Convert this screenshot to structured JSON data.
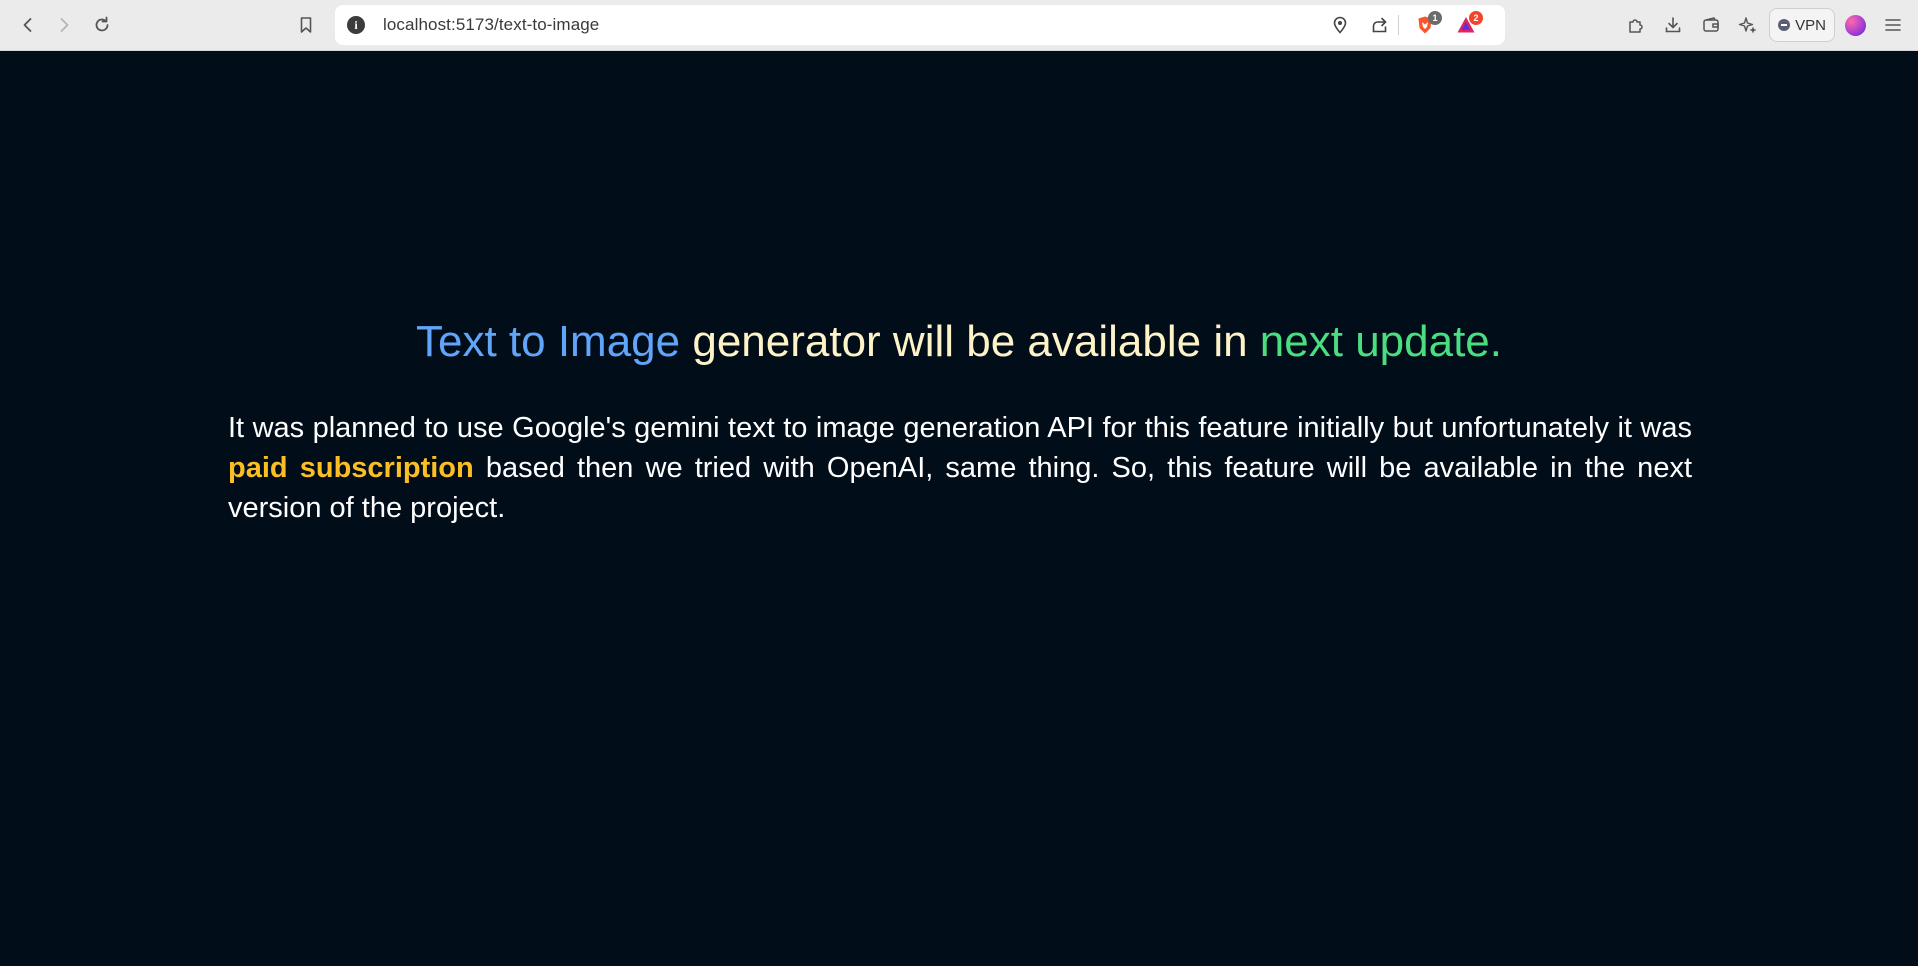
{
  "browser": {
    "url": "localhost:5173/text-to-image",
    "info_icon": "i",
    "brave_shield_count": "1",
    "rewards_count": "2",
    "vpn_label": "VPN"
  },
  "colors": {
    "page_background": "#020d1a",
    "heading_blue": "#60a5fa",
    "heading_cream": "#fef3c7",
    "heading_green": "#4ade80",
    "highlight_amber": "#fbbf24"
  },
  "icons": [
    "back-icon",
    "forward-icon",
    "reload-icon",
    "bookmark-icon",
    "info-icon",
    "location-icon",
    "share-icon",
    "brave-shield-icon",
    "brave-rewards-icon",
    "extensions-icon",
    "download-icon",
    "wallet-icon",
    "leo-ai-icon",
    "vpn-icon",
    "profile-avatar",
    "menu-icon"
  ],
  "page": {
    "heading": {
      "part1": "Text to Image",
      "part2": " generator will be available in ",
      "part3": "next update."
    },
    "paragraph": {
      "before": "It was planned to use Google's gemini text to image generation API for this feature initially but unfortunately it was ",
      "highlight": "paid subscription",
      "after": " based then we tried with OpenAI, same thing. So, this feature will be available in the next version of the project."
    }
  }
}
